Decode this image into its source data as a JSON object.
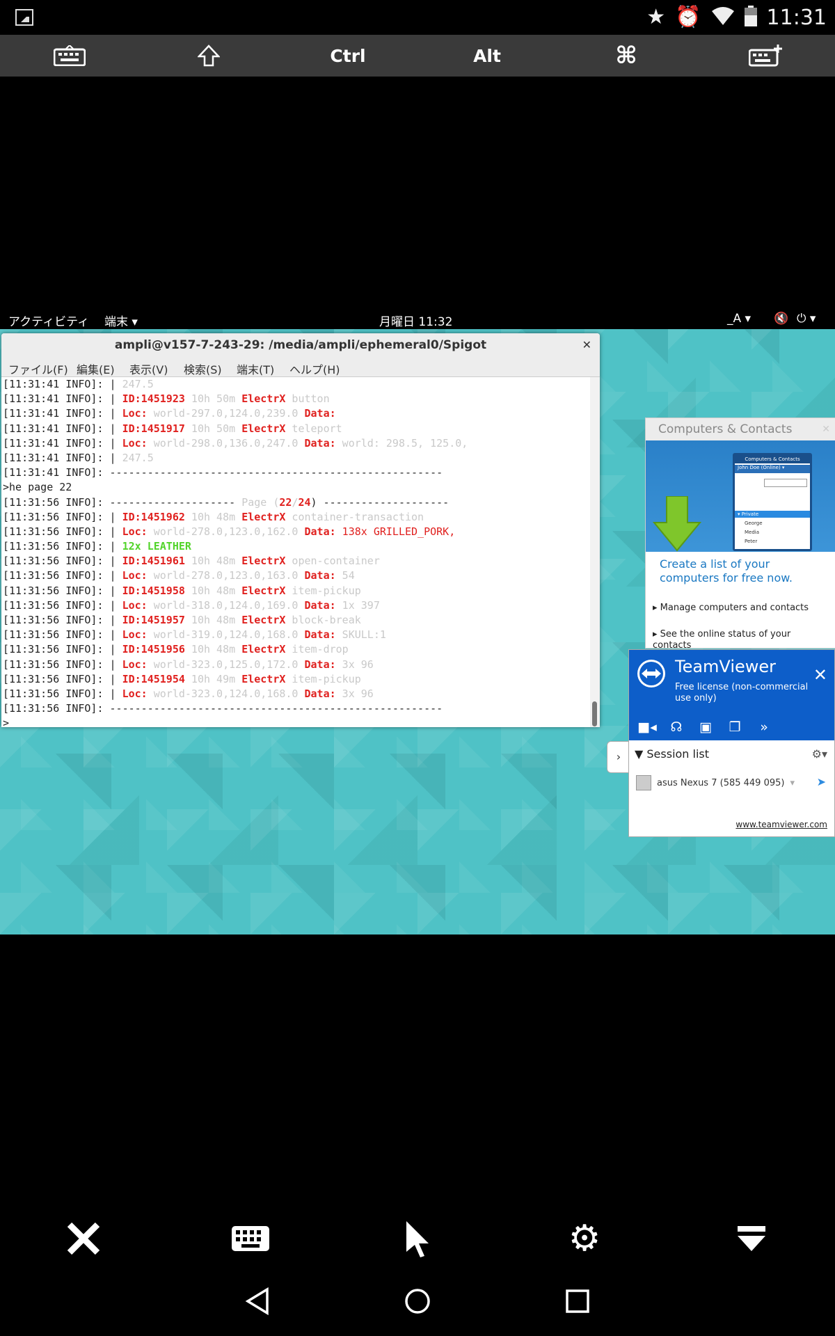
{
  "status_bar": {
    "time": "11:31",
    "icons": [
      "star-icon",
      "alarm-icon",
      "wifi-icon",
      "battery-icon"
    ]
  },
  "keyboard_bar": {
    "keys": [
      "keyboard-icon",
      "shift-icon",
      "Ctrl",
      "Alt",
      "command-icon",
      "keyboard-add-icon"
    ],
    "ctrl_label": "Ctrl",
    "alt_label": "Alt"
  },
  "desktop": {
    "topbar": {
      "activities": "アクティビティ",
      "app_menu": "端末 ▾",
      "clock": "月曜日 11:32",
      "input_method": "_A ▾",
      "power": "⏻ ▾"
    },
    "terminal": {
      "title": "ampli@v157-7-243-29: /media/ampli/ephemeral0/Spigot",
      "menu": [
        "ファイル(F)",
        "編集(E)",
        "表示(V)",
        "検索(S)",
        "端末(T)",
        "ヘルプ(H)"
      ],
      "lines": [
        {
          "prefix": "[11:31:41 INFO]: ",
          "a": "| ",
          "b": "",
          "c": "247.5",
          "d": "",
          "e": "",
          "f": ""
        },
        {
          "prefix": "[11:31:41 INFO]: ",
          "a": "| ",
          "b": "ID:1451923",
          "c": " 10h 50m ",
          "d": "ElectrX",
          "e": " button",
          "f": ""
        },
        {
          "prefix": "[11:31:41 INFO]: ",
          "a": "| ",
          "b": "Loc:",
          "c": " world-297.0,124.0,239.0 ",
          "d": "Data:",
          "e": "",
          "f": ""
        },
        {
          "prefix": "[11:31:41 INFO]: ",
          "a": "| ",
          "b": "ID:1451917",
          "c": " 10h 50m ",
          "d": "ElectrX",
          "e": " teleport",
          "f": ""
        },
        {
          "prefix": "[11:31:41 INFO]: ",
          "a": "| ",
          "b": "Loc:",
          "c": " world-298.0,136.0,247.0 ",
          "d": "Data:",
          "e": " world: 298.5, 125.0,",
          "f": ""
        },
        {
          "prefix": "[11:31:41 INFO]: ",
          "a": "| ",
          "b": "",
          "c": "247.5",
          "d": "",
          "e": "",
          "f": ""
        },
        {
          "prefix": "[11:31:41 INFO]: ",
          "a": "-----------------------------------------------------",
          "b": "",
          "c": "",
          "d": "",
          "e": "",
          "f": ""
        },
        {
          "prefix": ">he page 22",
          "a": "",
          "b": "",
          "c": "",
          "d": "",
          "e": "",
          "f": ""
        },
        {
          "prefix": "[11:31:56 INFO]: ",
          "a": "-------------------- ",
          "b": "",
          "c": "Page (",
          "d": "22",
          "e": "/",
          "f": "24"
        },
        {
          "prefix": "[11:31:56 INFO]: ",
          "a": "| ",
          "b": "ID:1451962",
          "c": " 10h 48m ",
          "d": "ElectrX",
          "e": " container-transaction",
          "f": ""
        },
        {
          "prefix": "[11:31:56 INFO]: ",
          "a": "| ",
          "b": "Loc:",
          "c": " world-278.0,123.0,162.0 ",
          "d": "Data:",
          "e": " 138x GRILLED_PORK,",
          "f": ""
        },
        {
          "prefix": "[11:31:56 INFO]: ",
          "a": "| ",
          "b": "",
          "c": "",
          "d": "",
          "e": "",
          "f": "12x LEATHER"
        },
        {
          "prefix": "[11:31:56 INFO]: ",
          "a": "| ",
          "b": "ID:1451961",
          "c": " 10h 48m ",
          "d": "ElectrX",
          "e": " open-container",
          "f": ""
        },
        {
          "prefix": "[11:31:56 INFO]: ",
          "a": "| ",
          "b": "Loc:",
          "c": " world-278.0,123.0,163.0 ",
          "d": "Data:",
          "e": " 54",
          "f": ""
        },
        {
          "prefix": "[11:31:56 INFO]: ",
          "a": "| ",
          "b": "ID:1451958",
          "c": " 10h 48m ",
          "d": "ElectrX",
          "e": " item-pickup",
          "f": ""
        },
        {
          "prefix": "[11:31:56 INFO]: ",
          "a": "| ",
          "b": "Loc:",
          "c": " world-318.0,124.0,169.0 ",
          "d": "Data:",
          "e": " 1x 397",
          "f": ""
        },
        {
          "prefix": "[11:31:56 INFO]: ",
          "a": "| ",
          "b": "ID:1451957",
          "c": " 10h 48m ",
          "d": "ElectrX",
          "e": " block-break",
          "f": ""
        },
        {
          "prefix": "[11:31:56 INFO]: ",
          "a": "| ",
          "b": "Loc:",
          "c": " world-319.0,124.0,168.0 ",
          "d": "Data:",
          "e": " SKULL:1",
          "f": ""
        },
        {
          "prefix": "[11:31:56 INFO]: ",
          "a": "| ",
          "b": "ID:1451956",
          "c": " 10h 48m ",
          "d": "ElectrX",
          "e": " item-drop",
          "f": ""
        },
        {
          "prefix": "[11:31:56 INFO]: ",
          "a": "| ",
          "b": "Loc:",
          "c": " world-323.0,125.0,172.0 ",
          "d": "Data:",
          "e": " 3x 96",
          "f": ""
        },
        {
          "prefix": "[11:31:56 INFO]: ",
          "a": "| ",
          "b": "ID:1451954",
          "c": " 10h 49m ",
          "d": "ElectrX",
          "e": " item-pickup",
          "f": ""
        },
        {
          "prefix": "[11:31:56 INFO]: ",
          "a": "| ",
          "b": "Loc:",
          "c": " world-323.0,124.0,168.0 ",
          "d": "Data:",
          "e": " 3x 96",
          "f": ""
        },
        {
          "prefix": "[11:31:56 INFO]: ",
          "a": "-----------------------------------------------------",
          "b": "",
          "c": "",
          "d": "",
          "e": "",
          "f": ""
        },
        {
          "prefix": ">",
          "a": "",
          "b": "",
          "c": "",
          "d": "",
          "e": "",
          "f": ""
        }
      ],
      "page_tail": ") --------------------"
    },
    "computers_contacts": {
      "title": "Computers & Contacts",
      "mini_title": "Computers & Contacts",
      "mini_user": "John Doe (Online) ▾",
      "mini_group": "▾ Private",
      "mini_contacts": [
        "George",
        "Media",
        "Peter"
      ],
      "cta": "Create a list of your computers for free now.",
      "bullets": [
        "Manage computers and contacts",
        "See the online status of your contacts"
      ]
    },
    "teamviewer": {
      "name": "TeamViewer",
      "license": "Free license (non-commercial use only)",
      "session_list": "Session list",
      "device": "asus Nexus 7 (585 449 095)",
      "link": "www.teamviewer.com"
    }
  },
  "remote_toolbar": [
    "close-icon",
    "keyboard-icon",
    "pointer-icon",
    "settings-icon",
    "collapse-icon"
  ],
  "nav_bar": [
    "back-icon",
    "home-icon",
    "recents-icon"
  ]
}
